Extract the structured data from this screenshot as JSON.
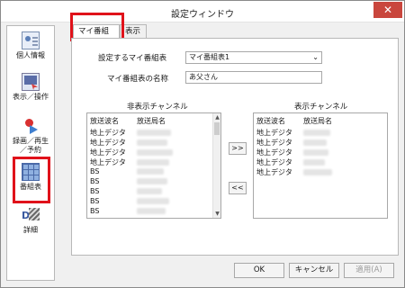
{
  "window": {
    "title": "設定ウィンドウ",
    "close_label": "✕"
  },
  "sidebar": {
    "items": [
      {
        "label": "個人情報",
        "icon": "person-card-icon"
      },
      {
        "label": "表示／操作",
        "icon": "display-pointer-icon"
      },
      {
        "label": "録画／再生／予約",
        "icon": "record-play-icon"
      },
      {
        "label": "番組表",
        "icon": "program-grid-icon"
      },
      {
        "label": "詳細",
        "icon": "detail-tools-icon"
      }
    ]
  },
  "tabs": [
    {
      "label": "マイ番組表"
    },
    {
      "label": "表示"
    }
  ],
  "form": {
    "select_label": "設定するマイ番組表",
    "select_value": "マイ番組表1",
    "name_label": "マイ番組表の名称",
    "name_value": "あ父さん"
  },
  "hidden_list": {
    "title": "非表示チャンネル",
    "headers": [
      "放送波名",
      "放送局名"
    ],
    "rows": [
      "地上デジタ",
      "地上デジタ",
      "地上デジタ",
      "地上デジタ",
      "BS",
      "BS",
      "BS",
      "BS",
      "BS"
    ]
  },
  "shown_list": {
    "title": "表示チャンネル",
    "headers": [
      "放送波名",
      "放送局名"
    ],
    "rows": [
      "地上デジタ",
      "地上デジタ",
      "地上デジタ",
      "地上デジタ",
      "地上デジタ"
    ]
  },
  "buttons": {
    "move_right": ">>",
    "move_left": "<<",
    "ok": "OK",
    "cancel": "キャンセル",
    "apply": "適用(A)"
  },
  "colors": {
    "highlight": "#e0121a"
  }
}
